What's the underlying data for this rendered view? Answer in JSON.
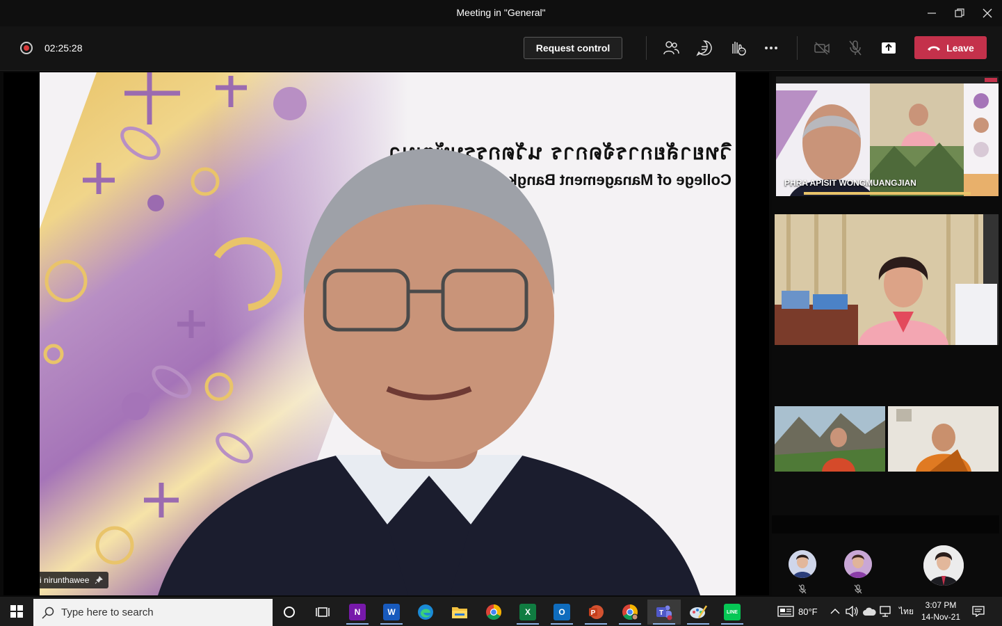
{
  "window": {
    "title": "Meeting in \"General\""
  },
  "toolbar": {
    "timer": "02:25:28",
    "request_control_label": "Request control",
    "leave_label": "Leave"
  },
  "main_video": {
    "presenter_name": "sakchai nirunthawee",
    "backdrop_title_th": "วิทยาลัยการจัดการ นวัตกรรมพัฒนา",
    "backdrop_subtitle_en": "College of Management Bangkok - University"
  },
  "participants": {
    "shared_tile_name": "PHRA APISIT WONGMUANGJIAN"
  },
  "taskbar": {
    "search_placeholder": "Type here to search",
    "weather": "80°F",
    "language": "ไทย",
    "time": "3:07 PM",
    "date": "14-Nov-21"
  },
  "colors": {
    "leave_red": "#c4314b",
    "record_red": "#d93a3a",
    "accent_purple": "#9b6bb0",
    "accent_yellow": "#e9c46a"
  }
}
